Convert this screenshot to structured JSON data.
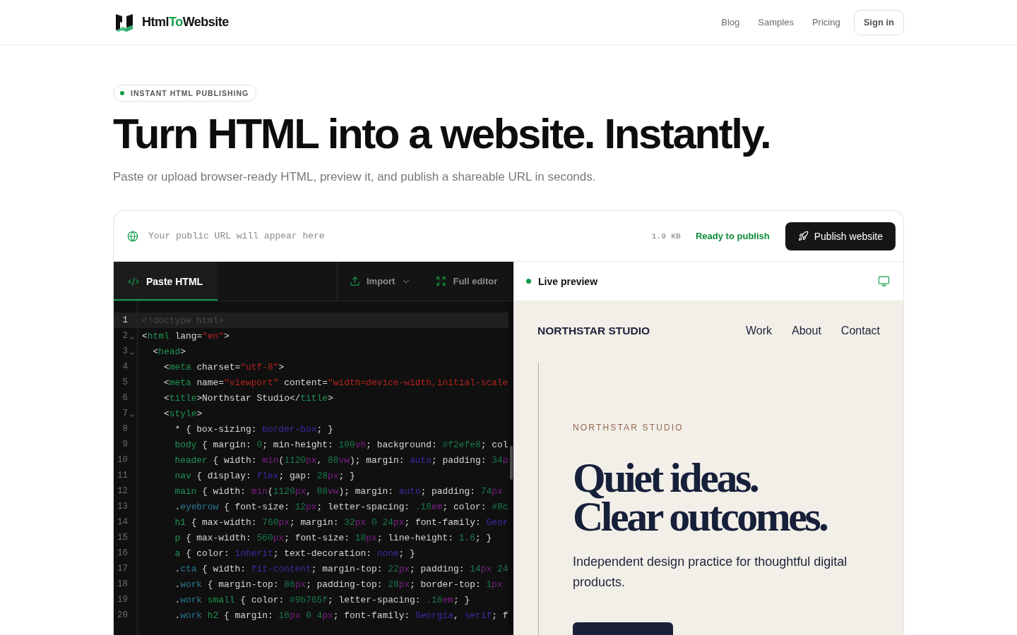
{
  "header": {
    "brand": [
      {
        "text": "Html",
        "accent": false
      },
      {
        "text": "To",
        "accent": true
      },
      {
        "text": "Website",
        "accent": false
      }
    ],
    "nav": [
      "Blog",
      "Samples",
      "Pricing"
    ],
    "sign_in": "Sign in"
  },
  "hero": {
    "badge": "INSTANT HTML PUBLISHING",
    "title": "Turn HTML into a website. Instantly.",
    "subtitle": "Paste or upload browser-ready HTML, preview it, and publish a shareable URL in seconds."
  },
  "publish_bar": {
    "url_placeholder": "Your public URL will appear here",
    "size": "1.9 KB",
    "status": "Ready to publish",
    "publish_button": "Publish website"
  },
  "editor": {
    "tabs": [
      {
        "label": "Paste HTML",
        "selected": true
      }
    ],
    "actions": [
      {
        "kind": "import",
        "label": "Import"
      },
      {
        "kind": "expand",
        "label": "Full editor"
      }
    ],
    "lines": [
      {
        "number": "1",
        "active": true,
        "tokens": [
          {
            "kind": "doctype",
            "text": "<!doctype html>"
          }
        ]
      },
      {
        "number": "2",
        "active": false,
        "tokens": [
          {
            "kind": "punct",
            "text": "<"
          },
          {
            "kind": "tag",
            "text": "html"
          },
          {
            "kind": "punct",
            "text": " lang="
          },
          {
            "kind": "string",
            "text": "\"en\""
          },
          {
            "kind": "punct",
            "text": ">"
          }
        ],
        "children": [
          {
            "number": "3",
            "active": false,
            "tokens": [
              {
                "kind": "punct",
                "text": "<"
              },
              {
                "kind": "tag",
                "text": "head"
              },
              {
                "kind": "punct",
                "text": ">"
              }
            ],
            "children": [
              {
                "number": "4",
                "active": false,
                "tokens": [
                  {
                    "kind": "punct",
                    "text": "<"
                  },
                  {
                    "kind": "tag",
                    "text": "meta"
                  },
                  {
                    "kind": "punct",
                    "text": " charset="
                  },
                  {
                    "kind": "string",
                    "text": "\"utf-8\""
                  },
                  {
                    "kind": "punct",
                    "text": ">"
                  }
                ]
              },
              {
                "number": "5",
                "active": false,
                "tokens": [
                  {
                    "kind": "punct",
                    "text": "<"
                  },
                  {
                    "kind": "tag",
                    "text": "meta"
                  },
                  {
                    "kind": "punct",
                    "text": " name="
                  },
                  {
                    "kind": "string",
                    "text": "\"viewport\""
                  },
                  {
                    "kind": "punct",
                    "text": " content="
                  },
                  {
                    "kind": "string",
                    "text": "\"width=device-width,initial-scale"
                  }
                ]
              },
              {
                "number": "6",
                "active": false,
                "tokens": [
                  {
                    "kind": "punct",
                    "text": "<"
                  },
                  {
                    "kind": "tag",
                    "text": "title"
                  },
                  {
                    "kind": "punct",
                    "text": ">Northstar Studio</"
                  },
                  {
                    "kind": "tag",
                    "text": "title"
                  },
                  {
                    "kind": "punct",
                    "text": ">"
                  }
                ]
              },
              {
                "number": "7",
                "active": false,
                "tokens": [
                  {
                    "kind": "punct",
                    "text": "<"
                  },
                  {
                    "kind": "tag",
                    "text": "style"
                  },
                  {
                    "kind": "punct",
                    "text": ">"
                  }
                ],
                "children": [
                  {
                    "number": "8",
                    "active": false,
                    "tokens": [
                      {
                        "kind": "punct",
                        "text": "* { box-sizing: "
                      },
                      {
                        "kind": "keyword",
                        "text": "border-box"
                      },
                      {
                        "kind": "punct",
                        "text": "; }"
                      }
                    ]
                  },
                  {
                    "number": "9",
                    "active": false,
                    "tokens": [
                      {
                        "kind": "selector",
                        "text": "body"
                      },
                      {
                        "kind": "punct",
                        "text": " { margin: "
                      },
                      {
                        "kind": "number",
                        "text": "0"
                      },
                      {
                        "kind": "punct",
                        "text": "; min-height: "
                      },
                      {
                        "kind": "number",
                        "text": "100"
                      },
                      {
                        "kind": "unit",
                        "text": "vh"
                      },
                      {
                        "kind": "punct",
                        "text": "; background: "
                      },
                      {
                        "kind": "number",
                        "text": "#f2efe8"
                      },
                      {
                        "kind": "punct",
                        "text": "; col"
                      }
                    ]
                  },
                  {
                    "number": "10",
                    "active": false,
                    "tokens": [
                      {
                        "kind": "selector",
                        "text": "header"
                      },
                      {
                        "kind": "punct",
                        "text": " { width: "
                      },
                      {
                        "kind": "func",
                        "text": "min"
                      },
                      {
                        "kind": "punct",
                        "text": "("
                      },
                      {
                        "kind": "number",
                        "text": "1120"
                      },
                      {
                        "kind": "unit",
                        "text": "px"
                      },
                      {
                        "kind": "punct",
                        "text": ", "
                      },
                      {
                        "kind": "number",
                        "text": "88"
                      },
                      {
                        "kind": "unit",
                        "text": "vw"
                      },
                      {
                        "kind": "punct",
                        "text": "); margin: "
                      },
                      {
                        "kind": "keyword",
                        "text": "auto"
                      },
                      {
                        "kind": "punct",
                        "text": "; padding: "
                      },
                      {
                        "kind": "number",
                        "text": "34"
                      },
                      {
                        "kind": "unit",
                        "text": "p"
                      }
                    ]
                  },
                  {
                    "number": "11",
                    "active": false,
                    "tokens": [
                      {
                        "kind": "selector",
                        "text": "nav"
                      },
                      {
                        "kind": "punct",
                        "text": " { display: "
                      },
                      {
                        "kind": "keyword",
                        "text": "flex"
                      },
                      {
                        "kind": "punct",
                        "text": "; gap: "
                      },
                      {
                        "kind": "number",
                        "text": "28"
                      },
                      {
                        "kind": "unit",
                        "text": "px"
                      },
                      {
                        "kind": "punct",
                        "text": "; }"
                      }
                    ]
                  },
                  {
                    "number": "12",
                    "active": false,
                    "tokens": [
                      {
                        "kind": "selector",
                        "text": "main"
                      },
                      {
                        "kind": "punct",
                        "text": " { width: "
                      },
                      {
                        "kind": "func",
                        "text": "min"
                      },
                      {
                        "kind": "punct",
                        "text": "("
                      },
                      {
                        "kind": "number",
                        "text": "1120"
                      },
                      {
                        "kind": "unit",
                        "text": "px"
                      },
                      {
                        "kind": "punct",
                        "text": ", "
                      },
                      {
                        "kind": "number",
                        "text": "88"
                      },
                      {
                        "kind": "unit",
                        "text": "vw"
                      },
                      {
                        "kind": "punct",
                        "text": "); margin: "
                      },
                      {
                        "kind": "keyword",
                        "text": "auto"
                      },
                      {
                        "kind": "punct",
                        "text": "; padding: "
                      },
                      {
                        "kind": "number",
                        "text": "74"
                      },
                      {
                        "kind": "unit",
                        "text": "px"
                      }
                    ]
                  },
                  {
                    "number": "13",
                    "active": false,
                    "tokens": [
                      {
                        "kind": "punct",
                        "text": "."
                      },
                      {
                        "kind": "class",
                        "text": "eyebrow"
                      },
                      {
                        "kind": "punct",
                        "text": " { font-size: "
                      },
                      {
                        "kind": "number",
                        "text": "12"
                      },
                      {
                        "kind": "unit",
                        "text": "px"
                      },
                      {
                        "kind": "punct",
                        "text": "; letter-spacing: "
                      },
                      {
                        "kind": "number",
                        "text": ".18"
                      },
                      {
                        "kind": "unit",
                        "text": "em"
                      },
                      {
                        "kind": "punct",
                        "text": "; color: "
                      },
                      {
                        "kind": "number",
                        "text": "#8c"
                      }
                    ]
                  },
                  {
                    "number": "14",
                    "active": false,
                    "tokens": [
                      {
                        "kind": "selector",
                        "text": "h1"
                      },
                      {
                        "kind": "punct",
                        "text": " { max-width: "
                      },
                      {
                        "kind": "number",
                        "text": "760"
                      },
                      {
                        "kind": "unit",
                        "text": "px"
                      },
                      {
                        "kind": "punct",
                        "text": "; margin: "
                      },
                      {
                        "kind": "number",
                        "text": "32"
                      },
                      {
                        "kind": "unit",
                        "text": "px"
                      },
                      {
                        "kind": "number",
                        "text": " 0"
                      },
                      {
                        "kind": "number",
                        "text": " 24"
                      },
                      {
                        "kind": "unit",
                        "text": "px"
                      },
                      {
                        "kind": "punct",
                        "text": "; font-family: "
                      },
                      {
                        "kind": "keyword",
                        "text": "Geor"
                      }
                    ]
                  },
                  {
                    "number": "15",
                    "active": false,
                    "tokens": [
                      {
                        "kind": "selector",
                        "text": "p"
                      },
                      {
                        "kind": "punct",
                        "text": " { max-width: "
                      },
                      {
                        "kind": "number",
                        "text": "560"
                      },
                      {
                        "kind": "unit",
                        "text": "px"
                      },
                      {
                        "kind": "punct",
                        "text": "; font-size: "
                      },
                      {
                        "kind": "number",
                        "text": "18"
                      },
                      {
                        "kind": "unit",
                        "text": "px"
                      },
                      {
                        "kind": "punct",
                        "text": "; line-height: "
                      },
                      {
                        "kind": "number",
                        "text": "1.6"
                      },
                      {
                        "kind": "punct",
                        "text": "; }"
                      }
                    ]
                  },
                  {
                    "number": "16",
                    "active": false,
                    "tokens": [
                      {
                        "kind": "selector",
                        "text": "a"
                      },
                      {
                        "kind": "punct",
                        "text": " { color: "
                      },
                      {
                        "kind": "keyword",
                        "text": "inherit"
                      },
                      {
                        "kind": "punct",
                        "text": "; text-decoration: "
                      },
                      {
                        "kind": "keyword",
                        "text": "none"
                      },
                      {
                        "kind": "punct",
                        "text": "; }"
                      }
                    ]
                  },
                  {
                    "number": "17",
                    "active": false,
                    "tokens": [
                      {
                        "kind": "punct",
                        "text": "."
                      },
                      {
                        "kind": "class",
                        "text": "cta"
                      },
                      {
                        "kind": "punct",
                        "text": " { width: "
                      },
                      {
                        "kind": "keyword",
                        "text": "fit-content"
                      },
                      {
                        "kind": "punct",
                        "text": "; margin-top: "
                      },
                      {
                        "kind": "number",
                        "text": "22"
                      },
                      {
                        "kind": "unit",
                        "text": "px"
                      },
                      {
                        "kind": "punct",
                        "text": "; padding: "
                      },
                      {
                        "kind": "number",
                        "text": "14"
                      },
                      {
                        "kind": "unit",
                        "text": "px"
                      },
                      {
                        "kind": "number",
                        "text": " 24"
                      }
                    ]
                  },
                  {
                    "number": "18",
                    "active": false,
                    "tokens": [
                      {
                        "kind": "punct",
                        "text": "."
                      },
                      {
                        "kind": "class",
                        "text": "work"
                      },
                      {
                        "kind": "punct",
                        "text": " { margin-top: "
                      },
                      {
                        "kind": "number",
                        "text": "86"
                      },
                      {
                        "kind": "unit",
                        "text": "px"
                      },
                      {
                        "kind": "punct",
                        "text": "; padding-top: "
                      },
                      {
                        "kind": "number",
                        "text": "28"
                      },
                      {
                        "kind": "unit",
                        "text": "px"
                      },
                      {
                        "kind": "punct",
                        "text": "; border-top: "
                      },
                      {
                        "kind": "number",
                        "text": "1"
                      },
                      {
                        "kind": "unit",
                        "text": "px"
                      }
                    ]
                  },
                  {
                    "number": "19",
                    "active": false,
                    "tokens": [
                      {
                        "kind": "punct",
                        "text": "."
                      },
                      {
                        "kind": "class",
                        "text": "work"
                      },
                      {
                        "kind": "selector",
                        "text": " small"
                      },
                      {
                        "kind": "punct",
                        "text": " { color: "
                      },
                      {
                        "kind": "number",
                        "text": "#9b765f"
                      },
                      {
                        "kind": "punct",
                        "text": "; letter-spacing: "
                      },
                      {
                        "kind": "number",
                        "text": ".16"
                      },
                      {
                        "kind": "unit",
                        "text": "em"
                      },
                      {
                        "kind": "punct",
                        "text": "; }"
                      }
                    ]
                  },
                  {
                    "number": "20",
                    "active": false,
                    "tokens": [
                      {
                        "kind": "punct",
                        "text": "."
                      },
                      {
                        "kind": "class",
                        "text": "work"
                      },
                      {
                        "kind": "selector",
                        "text": " h2"
                      },
                      {
                        "kind": "punct",
                        "text": " { margin: "
                      },
                      {
                        "kind": "number",
                        "text": "16"
                      },
                      {
                        "kind": "unit",
                        "text": "px"
                      },
                      {
                        "kind": "number",
                        "text": " 0"
                      },
                      {
                        "kind": "number",
                        "text": " 4"
                      },
                      {
                        "kind": "unit",
                        "text": "px"
                      },
                      {
                        "kind": "punct",
                        "text": "; font-family: "
                      },
                      {
                        "kind": "keyword",
                        "text": "Georgia"
                      },
                      {
                        "kind": "punct",
                        "text": ", "
                      },
                      {
                        "kind": "keyword",
                        "text": "serif"
                      },
                      {
                        "kind": "punct",
                        "text": "; f"
                      }
                    ]
                  }
                ]
              }
            ]
          }
        ]
      }
    ]
  },
  "preview": {
    "title": "Live preview",
    "site": {
      "brand": "NORTHSTAR STUDIO",
      "nav": [
        "Work",
        "About",
        "Contact"
      ],
      "eyebrow": "NORTHSTAR STUDIO",
      "headline": [
        "Quiet ideas.",
        "Clear outcomes."
      ],
      "lede": "Independent design practice for thoughtful digital products."
    }
  }
}
